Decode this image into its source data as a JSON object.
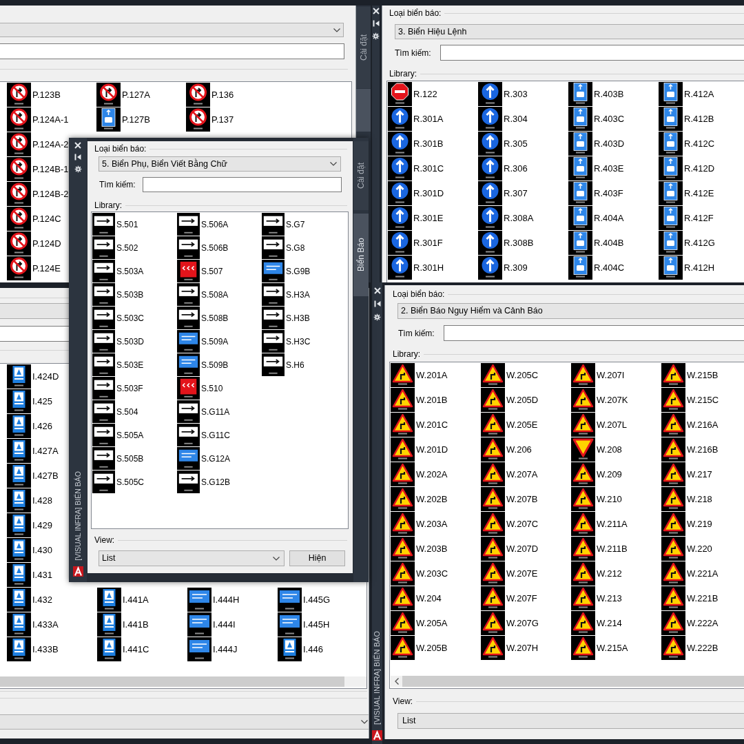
{
  "top_left_panel": {
    "side_tabs": [
      {
        "label": "Cài đặt",
        "selected": false
      },
      {
        "selected": true
      }
    ],
    "library": {
      "columns": [
        [
          {
            "code": "P.123B",
            "kind": "prohibition"
          },
          {
            "code": "P.124A-1",
            "kind": "prohibition"
          },
          {
            "code": "P.124A-2",
            "kind": "prohibition"
          },
          {
            "code": "P.124B-1",
            "kind": "prohibition"
          },
          {
            "code": "P.124B-2",
            "kind": "prohibition"
          },
          {
            "code": "P.124C",
            "kind": "prohibition"
          },
          {
            "code": "P.124D",
            "kind": "prohibition"
          },
          {
            "code": "P.124E",
            "kind": "prohibition"
          }
        ],
        [
          {
            "code": "P.127A",
            "kind": "prohibition"
          },
          {
            "code": "P.127B",
            "kind": "lane"
          }
        ],
        [
          {
            "code": "P.136",
            "kind": "prohibition"
          },
          {
            "code": "P.137",
            "kind": "prohibition"
          }
        ]
      ]
    }
  },
  "top_right_panel": {
    "type_label": "Loại biển báo:",
    "sign_type": "3. Biển Hiệu Lệnh",
    "search_label": "Tìm kiếm:",
    "library_label": "Library:",
    "library": {
      "columns": [
        [
          {
            "code": "R.122",
            "kind": "stop"
          },
          {
            "code": "R.301A",
            "kind": "mandatory"
          },
          {
            "code": "R.301B",
            "kind": "mandatory"
          },
          {
            "code": "R.301C",
            "kind": "mandatory"
          },
          {
            "code": "R.301D",
            "kind": "mandatory"
          },
          {
            "code": "R.301E",
            "kind": "mandatory"
          },
          {
            "code": "R.301F",
            "kind": "mandatory"
          },
          {
            "code": "R.301H",
            "kind": "mandatory"
          }
        ],
        [
          {
            "code": "R.303",
            "kind": "mandatory"
          },
          {
            "code": "R.304",
            "kind": "mandatory"
          },
          {
            "code": "R.305",
            "kind": "mandatory"
          },
          {
            "code": "R.306",
            "kind": "mandatory"
          },
          {
            "code": "R.307",
            "kind": "mandatory"
          },
          {
            "code": "R.308A",
            "kind": "mandatory"
          },
          {
            "code": "R.308B",
            "kind": "mandatory"
          },
          {
            "code": "R.309",
            "kind": "mandatory"
          }
        ],
        [
          {
            "code": "R.403B",
            "kind": "lane"
          },
          {
            "code": "R.403C",
            "kind": "lane"
          },
          {
            "code": "R.403D",
            "kind": "lane"
          },
          {
            "code": "R.403E",
            "kind": "lane"
          },
          {
            "code": "R.403F",
            "kind": "lane"
          },
          {
            "code": "R.404A",
            "kind": "lane"
          },
          {
            "code": "R.404B",
            "kind": "lane"
          },
          {
            "code": "R.404C",
            "kind": "lane"
          }
        ],
        [
          {
            "code": "R.412A",
            "kind": "lane"
          },
          {
            "code": "R.412B",
            "kind": "lane"
          },
          {
            "code": "R.412C",
            "kind": "lane"
          },
          {
            "code": "R.412D",
            "kind": "lane"
          },
          {
            "code": "R.412E",
            "kind": "lane"
          },
          {
            "code": "R.412F",
            "kind": "lane"
          },
          {
            "code": "R.412G",
            "kind": "lane"
          },
          {
            "code": "R.412H",
            "kind": "lane"
          }
        ]
      ]
    }
  },
  "bottom_left_panel": {
    "library": {
      "columns": [
        [
          {
            "code": "I.424D",
            "kind": "info"
          },
          {
            "code": "I.425",
            "kind": "info"
          },
          {
            "code": "I.426",
            "kind": "info"
          },
          {
            "code": "I.427A",
            "kind": "info"
          },
          {
            "code": "I.427B",
            "kind": "info"
          },
          {
            "code": "I.428",
            "kind": "info"
          },
          {
            "code": "I.429",
            "kind": "info"
          },
          {
            "code": "I.430",
            "kind": "info"
          },
          {
            "code": "I.431",
            "kind": "info"
          },
          {
            "code": "I.432",
            "kind": "info"
          },
          {
            "code": "I.433A",
            "kind": "info"
          },
          {
            "code": "I.433B",
            "kind": "info"
          }
        ],
        [
          {
            "code": "I.441A",
            "kind": "info"
          },
          {
            "code": "I.441B",
            "kind": "info"
          },
          {
            "code": "I.441C",
            "kind": "info"
          }
        ],
        [
          {
            "code": "I.444H",
            "kind": "blueplate"
          },
          {
            "code": "I.444I",
            "kind": "blueplate"
          },
          {
            "code": "I.444J",
            "kind": "blueplate"
          }
        ],
        [
          {
            "code": "I.445G",
            "kind": "blueplate"
          },
          {
            "code": "I.445H",
            "kind": "blueplate"
          },
          {
            "code": "I.446",
            "kind": "info"
          }
        ]
      ]
    }
  },
  "bottom_right_panel": {
    "title": "[VISUAL INFRA] BIỂN BÁO",
    "type_label": "Loại biển báo:",
    "sign_type": "2. Biển Báo Nguy Hiểm và Cảnh Báo",
    "search_label": "Tìm kiếm:",
    "library_label": "Library:",
    "library": {
      "columns": [
        [
          {
            "code": "W.201A",
            "kind": "warning"
          },
          {
            "code": "W.201B",
            "kind": "warning"
          },
          {
            "code": "W.201C",
            "kind": "warning"
          },
          {
            "code": "W.201D",
            "kind": "warning"
          },
          {
            "code": "W.202A",
            "kind": "warning"
          },
          {
            "code": "W.202B",
            "kind": "warning"
          },
          {
            "code": "W.203A",
            "kind": "warning"
          },
          {
            "code": "W.203B",
            "kind": "warning"
          },
          {
            "code": "W.203C",
            "kind": "warning"
          },
          {
            "code": "W.204",
            "kind": "warning"
          },
          {
            "code": "W.205A",
            "kind": "warning"
          },
          {
            "code": "W.205B",
            "kind": "warning"
          }
        ],
        [
          {
            "code": "W.205C",
            "kind": "warning"
          },
          {
            "code": "W.205D",
            "kind": "warning"
          },
          {
            "code": "W.205E",
            "kind": "warning"
          },
          {
            "code": "W.206",
            "kind": "warning"
          },
          {
            "code": "W.207A",
            "kind": "warning"
          },
          {
            "code": "W.207B",
            "kind": "warning"
          },
          {
            "code": "W.207C",
            "kind": "warning"
          },
          {
            "code": "W.207D",
            "kind": "warning"
          },
          {
            "code": "W.207E",
            "kind": "warning"
          },
          {
            "code": "W.207F",
            "kind": "warning"
          },
          {
            "code": "W.207G",
            "kind": "warning"
          },
          {
            "code": "W.207H",
            "kind": "warning"
          }
        ],
        [
          {
            "code": "W.207I",
            "kind": "warning"
          },
          {
            "code": "W.207K",
            "kind": "warning"
          },
          {
            "code": "W.207L",
            "kind": "warning"
          },
          {
            "code": "W.208",
            "kind": "yield"
          },
          {
            "code": "W.209",
            "kind": "warning"
          },
          {
            "code": "W.210",
            "kind": "warning"
          },
          {
            "code": "W.211A",
            "kind": "warning"
          },
          {
            "code": "W.211B",
            "kind": "warning"
          },
          {
            "code": "W.212",
            "kind": "warning"
          },
          {
            "code": "W.213",
            "kind": "warning"
          },
          {
            "code": "W.214",
            "kind": "warning"
          },
          {
            "code": "W.215A",
            "kind": "warning"
          }
        ],
        [
          {
            "code": "W.215B",
            "kind": "warning"
          },
          {
            "code": "W.215C",
            "kind": "warning"
          },
          {
            "code": "W.216A",
            "kind": "warning"
          },
          {
            "code": "W.216B",
            "kind": "warning"
          },
          {
            "code": "W.217",
            "kind": "warning"
          },
          {
            "code": "W.218",
            "kind": "warning"
          },
          {
            "code": "W.219",
            "kind": "warning"
          },
          {
            "code": "W.220",
            "kind": "warning"
          },
          {
            "code": "W.221A",
            "kind": "warning"
          },
          {
            "code": "W.221B",
            "kind": "warning"
          },
          {
            "code": "W.222A",
            "kind": "warning"
          },
          {
            "code": "W.222B",
            "kind": "warning"
          }
        ]
      ]
    },
    "view_label": "View:",
    "view_mode": "List"
  },
  "floating_panel": {
    "title": "[VISUAL INFRA] BIỂN BÁO",
    "side_tabs": [
      {
        "label": "Cài đặt",
        "selected": false
      },
      {
        "label": "Biển Báo",
        "selected": true
      }
    ],
    "type_label": "Loại biển báo:",
    "sign_type": "5. Biển Phụ, Biển Viết Bằng Chữ",
    "search_label": "Tìm kiếm:",
    "library_label": "Library:",
    "library": {
      "columns": [
        [
          {
            "code": "S.501",
            "kind": "plate"
          },
          {
            "code": "S.502",
            "kind": "plate"
          },
          {
            "code": "S.503A",
            "kind": "plate"
          },
          {
            "code": "S.503B",
            "kind": "plate"
          },
          {
            "code": "S.503C",
            "kind": "plate"
          },
          {
            "code": "S.503D",
            "kind": "plate"
          },
          {
            "code": "S.503E",
            "kind": "plate"
          },
          {
            "code": "S.503F",
            "kind": "plate"
          },
          {
            "code": "S.504",
            "kind": "plate"
          },
          {
            "code": "S.505A",
            "kind": "plate"
          },
          {
            "code": "S.505B",
            "kind": "plate"
          },
          {
            "code": "S.505C",
            "kind": "plate"
          }
        ],
        [
          {
            "code": "S.506A",
            "kind": "plate"
          },
          {
            "code": "S.506B",
            "kind": "plate"
          },
          {
            "code": "S.507",
            "kind": "redplate"
          },
          {
            "code": "S.508A",
            "kind": "plate"
          },
          {
            "code": "S.508B",
            "kind": "plate"
          },
          {
            "code": "S.509A",
            "kind": "blueplate"
          },
          {
            "code": "S.509B",
            "kind": "blueplate"
          },
          {
            "code": "S.510",
            "kind": "redplate"
          },
          {
            "code": "S.G11A",
            "kind": "plate"
          },
          {
            "code": "S.G11C",
            "kind": "plate"
          },
          {
            "code": "S.G12A",
            "kind": "blueplate"
          },
          {
            "code": "S.G12B",
            "kind": "plate"
          }
        ],
        [
          {
            "code": "S.G7",
            "kind": "plate"
          },
          {
            "code": "S.G8",
            "kind": "plate"
          },
          {
            "code": "S.G9B",
            "kind": "blueplate"
          },
          {
            "code": "S.H3A",
            "kind": "plate"
          },
          {
            "code": "S.H3B",
            "kind": "plate"
          },
          {
            "code": "S.H3C",
            "kind": "plate"
          },
          {
            "code": "S.H6",
            "kind": "plate"
          }
        ]
      ]
    },
    "view_label": "View:",
    "view_mode": "List",
    "show_button": "Hiện"
  }
}
